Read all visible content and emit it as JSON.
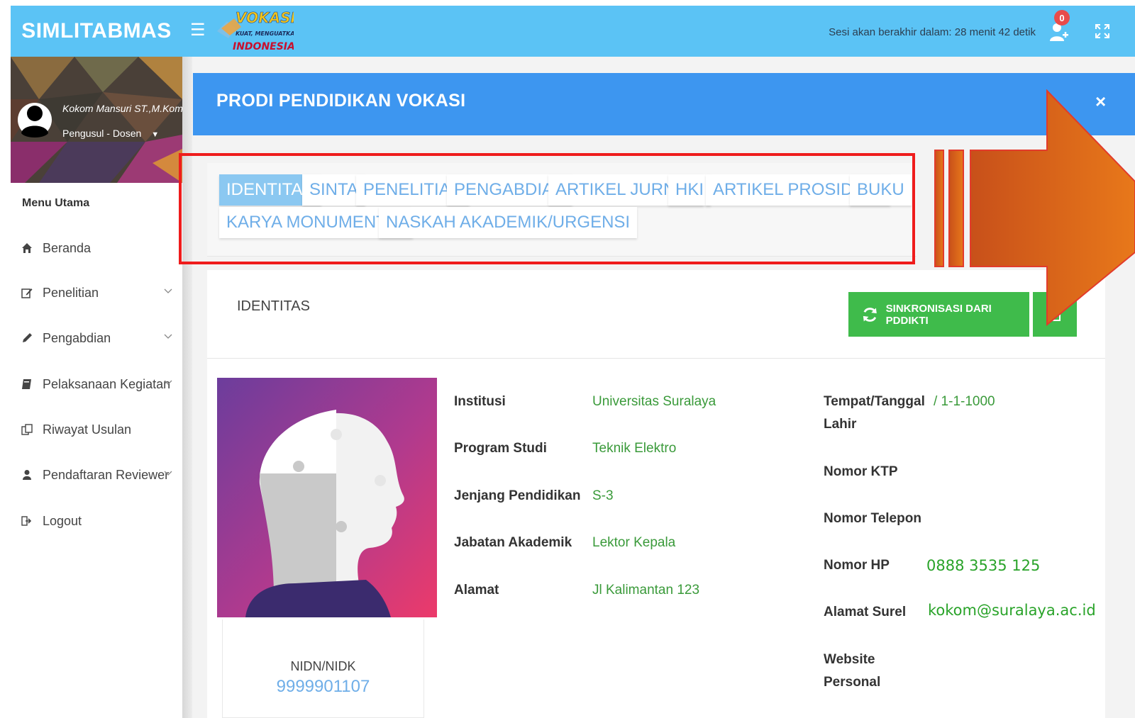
{
  "app": {
    "brand": "SIMLITABMAS",
    "logo_text_line1": "VOKASI",
    "logo_text_line2": "KUAT, MENGUATKAN",
    "logo_text_line3": "INDONESIA"
  },
  "topbar": {
    "menu_icon": "☰",
    "session_text": "Sesi akan berakhir dalam: 28 menit 42 detik",
    "notif_count": "0"
  },
  "profile": {
    "name": "Kokom Mansuri ST.,M.Kom",
    "role": "Pengusul - Dosen"
  },
  "sidebar": {
    "menu_title": "Menu Utama",
    "items": [
      {
        "label": "Beranda",
        "icon": "home-icon"
      },
      {
        "label": "Penelitian",
        "icon": "edit-icon"
      },
      {
        "label": "Pengabdian",
        "icon": "pencil-icon"
      },
      {
        "label": "Pelaksanaan Kegiatan",
        "icon": "book-icon"
      },
      {
        "label": "Riwayat Usulan",
        "icon": "copy-icon"
      },
      {
        "label": "Pendaftaran Reviewer",
        "icon": "user-icon"
      },
      {
        "label": "Logout",
        "icon": "logout-icon"
      }
    ]
  },
  "page": {
    "title": "PRODI PENDIDIKAN VOKASI",
    "close": "×"
  },
  "tabs": [
    {
      "label": "IDENTITAS"
    },
    {
      "label": "SINTA"
    },
    {
      "label": "PENELITIAN"
    },
    {
      "label": "PENGABDIAN"
    },
    {
      "label": "ARTIKEL JURNAL"
    },
    {
      "label": "HKI"
    },
    {
      "label": "ARTIKEL PROSIDING"
    },
    {
      "label": "BUKU"
    },
    {
      "label": "KARYA MONUMENTAL"
    },
    {
      "label": "NASKAH AKADEMIK/URGENSI"
    }
  ],
  "identity": {
    "section_title": "IDENTITAS",
    "sync_button": "SINKRONISASI DARI PDDIKTI",
    "nidn_label": "NIDN/NIDK",
    "nidn_value": "9999901107",
    "left_fields": [
      {
        "label": "Institusi",
        "value": "Universitas Suralaya"
      },
      {
        "label": "Program Studi",
        "value": "Teknik Elektro"
      },
      {
        "label": "Jenjang Pendidikan",
        "value": "S-3"
      },
      {
        "label": "Jabatan Akademik",
        "value": "Lektor Kepala"
      },
      {
        "label": "Alamat",
        "value": "Jl Kalimantan 123"
      }
    ],
    "right_fields": [
      {
        "label_line1": "Tempat/Tanggal",
        "label_line2": "Lahir",
        "value": "/ 1-1-1000"
      },
      {
        "label": "Nomor KTP",
        "value": ""
      },
      {
        "label": "Nomor Telepon",
        "value": ""
      },
      {
        "label": "Nomor HP",
        "value": "0888 3535 125"
      },
      {
        "label": "Alamat Surel",
        "value": "kokom@suralaya.ac.id"
      },
      {
        "label_line1": "Website",
        "label_line2": "Personal",
        "value": ""
      }
    ]
  },
  "colors": {
    "topbar": "#5bc3f5",
    "header": "#3d96f0",
    "active_tab": "#8bc8f1",
    "tab_text": "#6faee8",
    "sync_button": "#3fbb4b",
    "highlight_box": "#ef1c1c",
    "arrow": "#e0701c",
    "value_green": "#3a9a3a"
  }
}
